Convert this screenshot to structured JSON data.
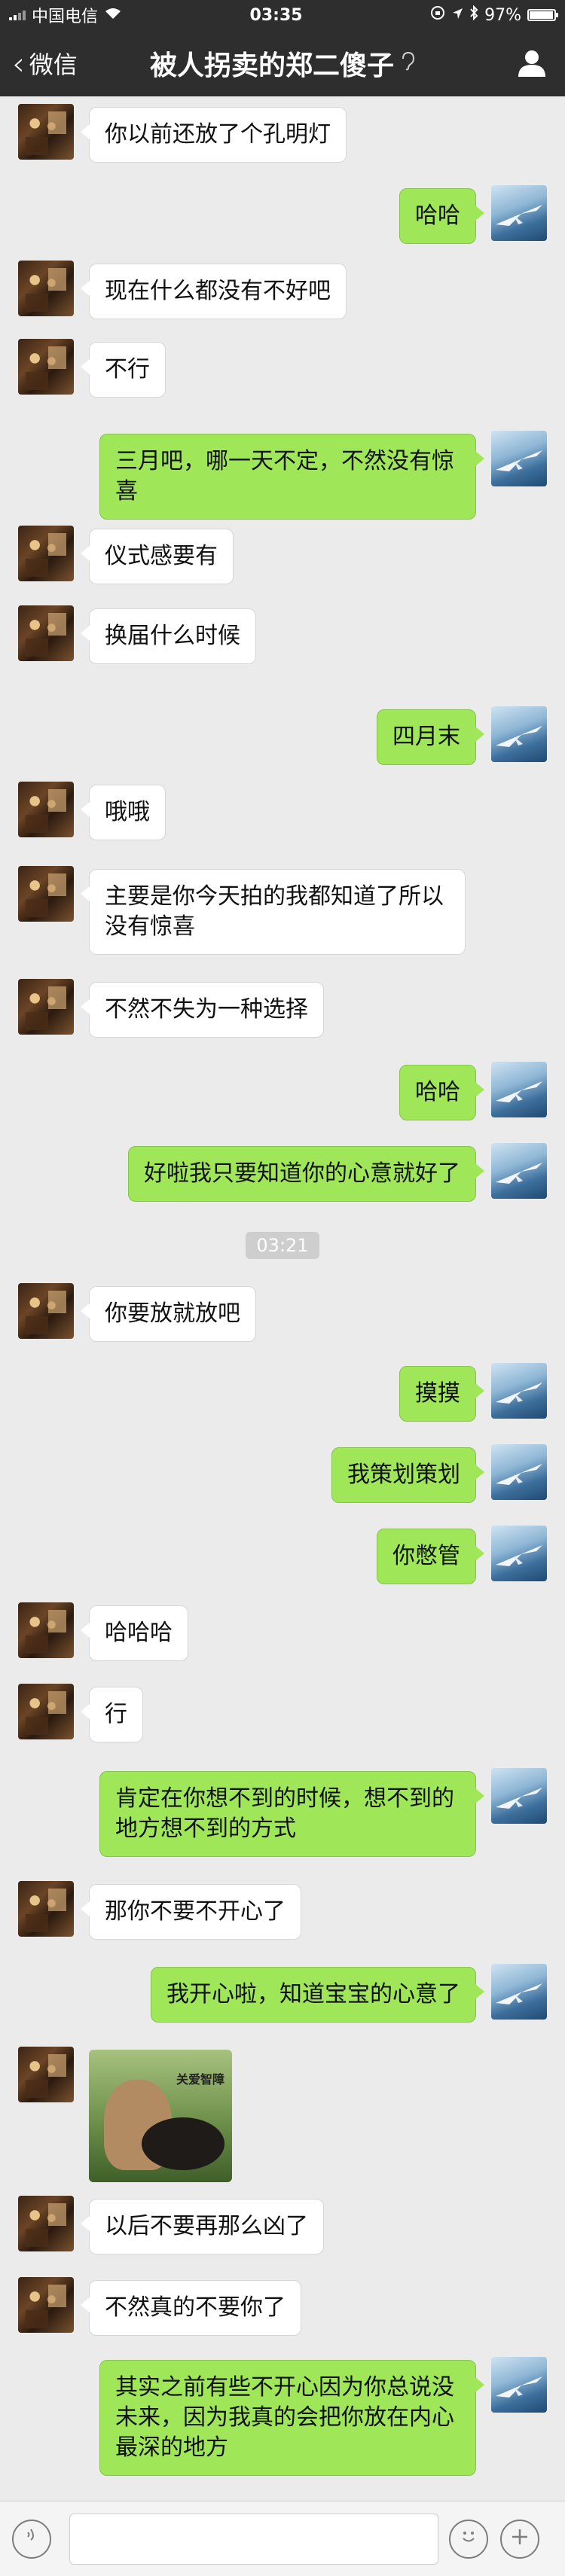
{
  "status_bar": {
    "carrier": "中国电信",
    "time": "03:35",
    "battery_percent": "97%",
    "battery_level": 0.97
  },
  "nav": {
    "back_label": "微信",
    "title": "被人拐卖的郑二傻子",
    "ear_icon": "ear-icon",
    "user_icon": "person-icon"
  },
  "messages": [
    {
      "side": "in",
      "text": "你以前还放了个孔明灯"
    },
    {
      "side": "out",
      "text": "哈哈"
    },
    {
      "side": "in",
      "text": "现在什么都没有不好吧"
    },
    {
      "side": "in",
      "text": "不行"
    },
    {
      "side": "out",
      "text": "三月吧，哪一天不定，不然没有惊喜"
    },
    {
      "side": "in",
      "text": "仪式感要有"
    },
    {
      "side": "in",
      "text": "换届什么时候"
    },
    {
      "side": "out",
      "text": "四月末"
    },
    {
      "side": "in",
      "text": "哦哦"
    },
    {
      "side": "in",
      "text": "主要是你今天拍的我都知道了所以没有惊喜"
    },
    {
      "side": "in",
      "text": "不然不失为一种选择"
    },
    {
      "side": "out",
      "text": "哈哈"
    },
    {
      "side": "out",
      "text": "好啦我只要知道你的心意就好了"
    },
    {
      "side": "time",
      "text": "03:21"
    },
    {
      "side": "in",
      "text": "你要放就放吧"
    },
    {
      "side": "out",
      "text": "摸摸"
    },
    {
      "side": "out",
      "text": "我策划策划"
    },
    {
      "side": "out",
      "text": "你憋管"
    },
    {
      "side": "in",
      "text": "哈哈哈"
    },
    {
      "side": "in",
      "text": "行"
    },
    {
      "side": "out",
      "text": "肯定在你想不到的时候，想不到的地方想不到的方式"
    },
    {
      "side": "in",
      "text": "那你不要不开心了"
    },
    {
      "side": "out",
      "text": "我开心啦，知道宝宝的心意了"
    },
    {
      "side": "in",
      "sticker": true,
      "caption": "关爱智障"
    },
    {
      "side": "in",
      "text": "以后不要再那么凶了"
    },
    {
      "side": "in",
      "text": "不然真的不要你了"
    },
    {
      "side": "out",
      "text": "其实之前有些不开心因为你总说没未来，因为我真的会把你放在内心最深的地方"
    }
  ],
  "input_bar": {
    "voice_icon": "voice-icon",
    "emoji_icon": "emoji-icon",
    "plus_icon": "plus-icon"
  }
}
